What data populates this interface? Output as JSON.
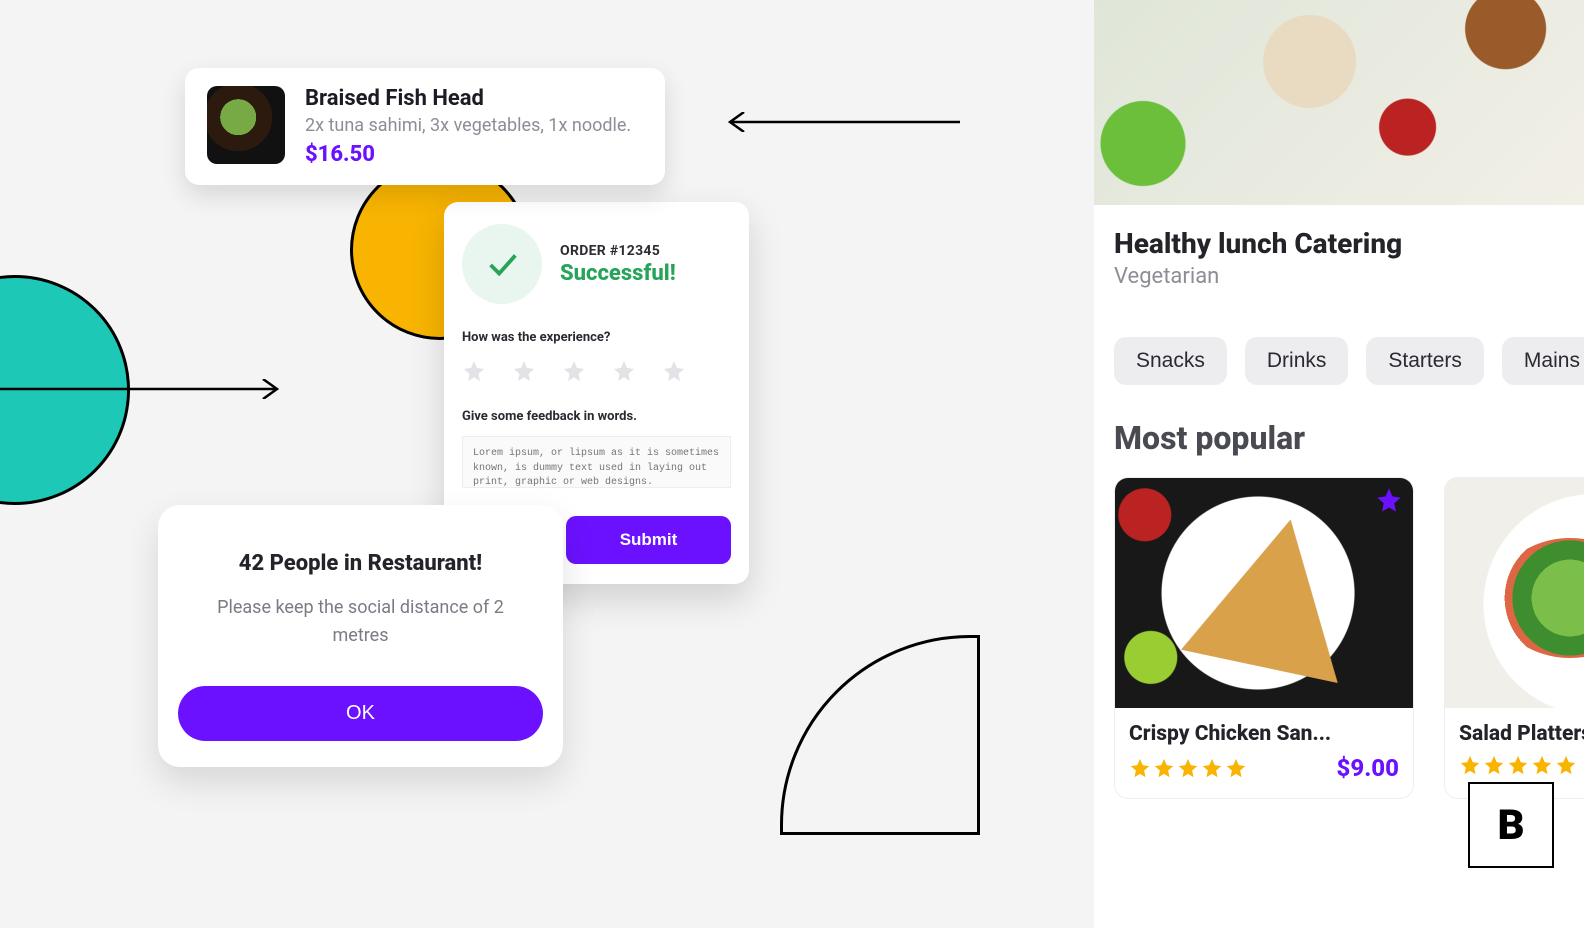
{
  "orderItem": {
    "title": "Braised Fish Head",
    "desc": "2x tuna sahimi, 3x vegetables, 1x noodle.",
    "price": "$16.50"
  },
  "feedback": {
    "orderLabel": "ORDER #12345",
    "statusText": "Successful!",
    "q1": "How was the experience?",
    "q2": "Give some feedback in words.",
    "placeholder": "Lorem ipsum, or lipsum as it is sometimes known, is dummy text used in laying out print, graphic or web designs.",
    "submitLabel": "Submit"
  },
  "alert": {
    "title": "42 People in Restaurant!",
    "body": "Please keep the social distance of 2 metres",
    "okLabel": "OK"
  },
  "store": {
    "title": "Healthy lunch Catering",
    "subtitle": "Vegetarian",
    "chips": [
      "Snacks",
      "Drinks",
      "Starters",
      "Mains"
    ],
    "sectionHeader": "Most popular",
    "products": [
      {
        "name": "Crispy Chicken San...",
        "price": "$9.00",
        "stars": 5,
        "favorite": true
      },
      {
        "name": "Salad Platters",
        "price": "",
        "stars": 5,
        "favorite": false
      }
    ]
  },
  "brand": {
    "letter": "B"
  },
  "colors": {
    "accent": "#6b11ff",
    "success": "#27a35a",
    "gold": "#f8b400",
    "teal": "#1ec8b6"
  }
}
